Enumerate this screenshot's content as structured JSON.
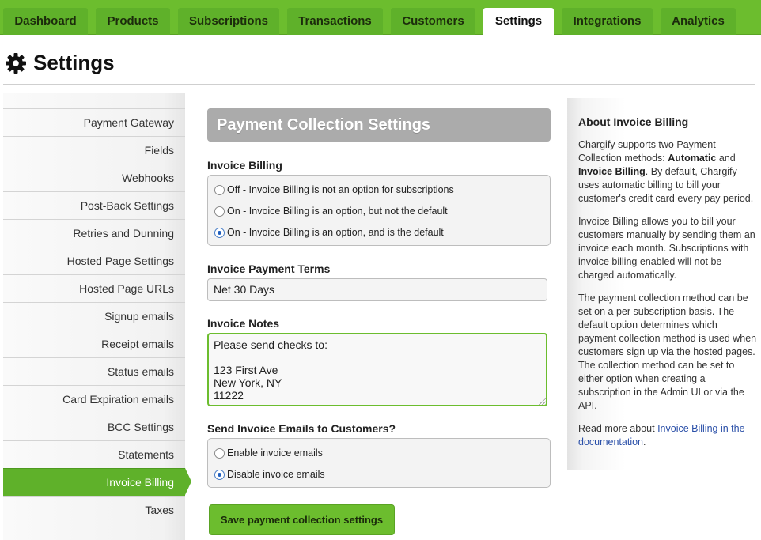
{
  "nav": {
    "tabs": [
      {
        "label": "Dashboard"
      },
      {
        "label": "Products"
      },
      {
        "label": "Subscriptions"
      },
      {
        "label": "Transactions"
      },
      {
        "label": "Customers"
      },
      {
        "label": "Settings"
      },
      {
        "label": "Integrations"
      },
      {
        "label": "Analytics"
      }
    ],
    "active_tab": "Settings"
  },
  "header": {
    "title": "Settings",
    "icon": "gear-icon"
  },
  "sidebar": {
    "items": [
      {
        "label": "Payment Gateway"
      },
      {
        "label": "Fields"
      },
      {
        "label": "Webhooks"
      },
      {
        "label": "Post-Back Settings"
      },
      {
        "label": "Retries and Dunning"
      },
      {
        "label": "Hosted Page Settings"
      },
      {
        "label": "Hosted Page URLs"
      },
      {
        "label": "Signup emails"
      },
      {
        "label": "Receipt emails"
      },
      {
        "label": "Status emails"
      },
      {
        "label": "Card Expiration emails"
      },
      {
        "label": "BCC Settings"
      },
      {
        "label": "Statements"
      },
      {
        "label": "Invoice Billing"
      },
      {
        "label": "Taxes"
      }
    ],
    "active_item": "Invoice Billing"
  },
  "form": {
    "title": "Payment Collection Settings",
    "invoice_billing": {
      "label": "Invoice Billing",
      "options": [
        {
          "label": "Off - Invoice Billing is not an option for subscriptions",
          "checked": false
        },
        {
          "label": "On - Invoice Billing is an option, but not the default",
          "checked": false
        },
        {
          "label": "On - Invoice Billing is an option, and is the default",
          "checked": true
        }
      ]
    },
    "payment_terms": {
      "label": "Invoice Payment Terms",
      "value": "Net 30 Days"
    },
    "notes": {
      "label": "Invoice Notes",
      "value": "Please send checks to:\n\n123 First Ave\nNew York, NY\n11222"
    },
    "send_emails": {
      "label": "Send Invoice Emails to Customers?",
      "options": [
        {
          "label": "Enable invoice emails",
          "checked": false
        },
        {
          "label": "Disable invoice emails",
          "checked": true
        }
      ]
    },
    "save_label": "Save payment collection settings"
  },
  "info": {
    "title": "About Invoice Billing",
    "p1_a": "Chargify supports two Payment Collection methods: ",
    "p1_automatic": "Automatic",
    "p1_and": " and ",
    "p1_invoice": "Invoice Billing",
    "p1_b": ". By default, Chargify uses automatic billing to bill your customer's credit card every pay period.",
    "p2": "Invoice Billing allows you to bill your customers manually by sending them an invoice each month. Subscriptions with invoice billing enabled will not be charged automatically.",
    "p3": "The payment collection method can be set on a per subscription basis. The default option determines which payment collection method is used when customers sign up via the hosted pages. The collection method can be set to either option when creating a subscription in the Admin UI or via the API.",
    "p4_a": "Read more about ",
    "p4_link": "Invoice Billing in the documentation",
    "p4_b": "."
  },
  "colors": {
    "accent": "#6cbd2e",
    "active_tab": "#ffffff",
    "link": "#2a4fa8",
    "panel_title": "#ababab"
  }
}
